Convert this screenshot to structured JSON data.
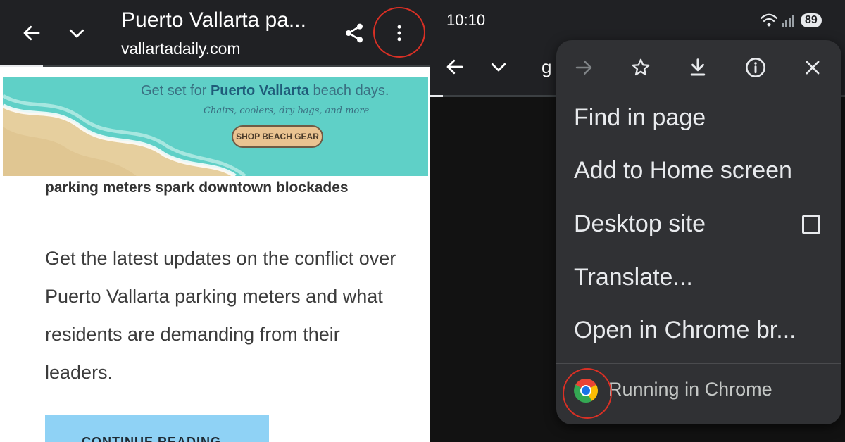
{
  "left_panel": {
    "toolbar": {
      "title": "Puerto Vallarta pa...",
      "url": "vallartadaily.com",
      "back_icon": "back-arrow-icon",
      "tabs_icon": "chevron-down-icon",
      "share_icon": "share-icon",
      "more_icon": "more-vert-icon"
    },
    "page_load_progress": 0.1,
    "banner": {
      "headline_prefix": "Get set for ",
      "headline_bold": "Puerto Vallarta",
      "headline_suffix": " beach days.",
      "subline": "Chairs, coolers, dry bags, and more",
      "button_label": "SHOP BEACH GEAR"
    },
    "article": {
      "headline": "parking meters spark downtown blockades",
      "body": "Get the latest updates on the conflict over Puerto Vallarta parking meters and what residents are demanding from their leaders.",
      "cta_label": "CONTINUE READING"
    }
  },
  "right_panel": {
    "status_bar": {
      "time": "10:10",
      "battery": "89",
      "wifi_icon": "wifi-icon",
      "signal_icon": "signal-icon"
    },
    "toolbar": {
      "url_partial": "g",
      "back_icon": "back-arrow-icon",
      "tabs_icon": "chevron-down-icon"
    },
    "page_load_progress": 0.03,
    "menu": {
      "top_icons": [
        "forward-arrow-icon",
        "star-icon",
        "download-icon",
        "info-icon",
        "close-icon"
      ],
      "items": [
        {
          "label": "Find in page"
        },
        {
          "label": "Add to Home screen"
        },
        {
          "label": "Desktop site",
          "checked": false
        },
        {
          "label": "Translate..."
        },
        {
          "label": "Open in Chrome br..."
        }
      ],
      "footer_label": "Running in Chrome",
      "footer_icon": "chrome-logo-icon"
    }
  },
  "colors": {
    "toolbar_bg": "#202124",
    "menu_bg": "#303134",
    "highlight_ring": "#d93025",
    "banner_sea": "#5fd0c7",
    "cta_bg": "#8fd2f5"
  }
}
